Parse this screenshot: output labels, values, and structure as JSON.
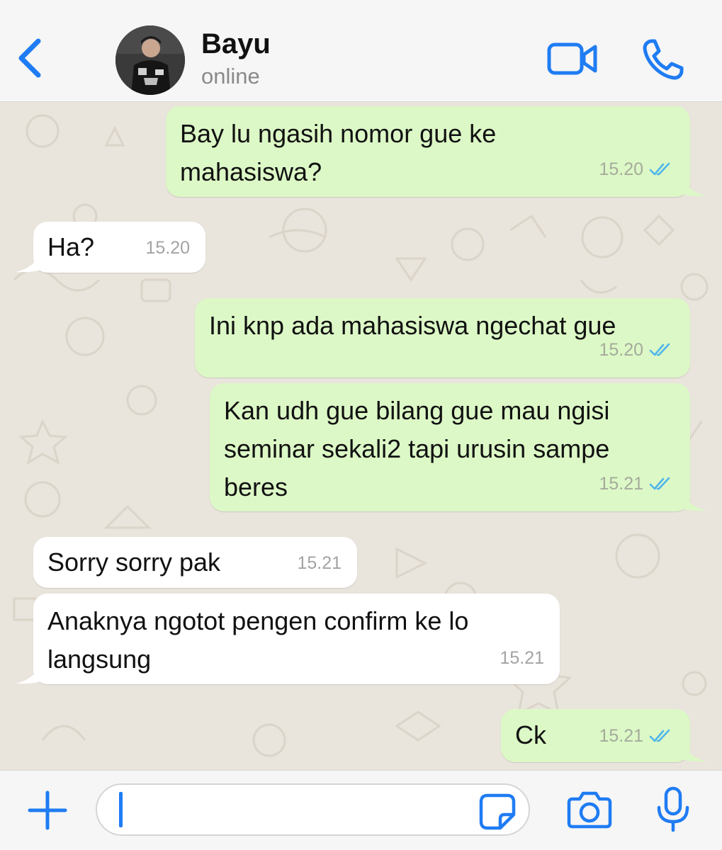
{
  "header": {
    "contact_name": "Bayu",
    "status": "online"
  },
  "icons": {
    "back": "chevron-left-icon",
    "video": "video-camera-icon",
    "call": "phone-icon",
    "plus": "plus-icon",
    "sticker": "sticker-icon",
    "camera": "camera-icon",
    "mic": "microphone-icon"
  },
  "colors": {
    "accent": "#1f7cf3",
    "outgoing_bubble": "#dcf8c6",
    "incoming_bubble": "#ffffff",
    "read_ticks": "#4fb6ec"
  },
  "messages": [
    {
      "direction": "outgoing",
      "text": "Bay lu ngasih nomor gue ke\nmahasiswa?",
      "time": "15.20",
      "status": "read"
    },
    {
      "direction": "incoming",
      "text": "Ha?",
      "time": "15.20"
    },
    {
      "direction": "outgoing",
      "text": "Ini knp ada mahasiswa ngechat gue",
      "time": "15.20",
      "status": "read"
    },
    {
      "direction": "outgoing",
      "text": "Kan udh gue bilang gue mau ngisi\nseminar sekali2 tapi urusin sampe\nberes",
      "time": "15.21",
      "status": "read"
    },
    {
      "direction": "incoming",
      "text": "Sorry sorry pak",
      "time": "15.21"
    },
    {
      "direction": "incoming",
      "text": "Anaknya ngotot pengen confirm ke lo\nlangsung",
      "time": "15.21"
    },
    {
      "direction": "outgoing",
      "text": "Ck",
      "time": "15.21",
      "status": "read"
    }
  ],
  "composer": {
    "value": ""
  }
}
